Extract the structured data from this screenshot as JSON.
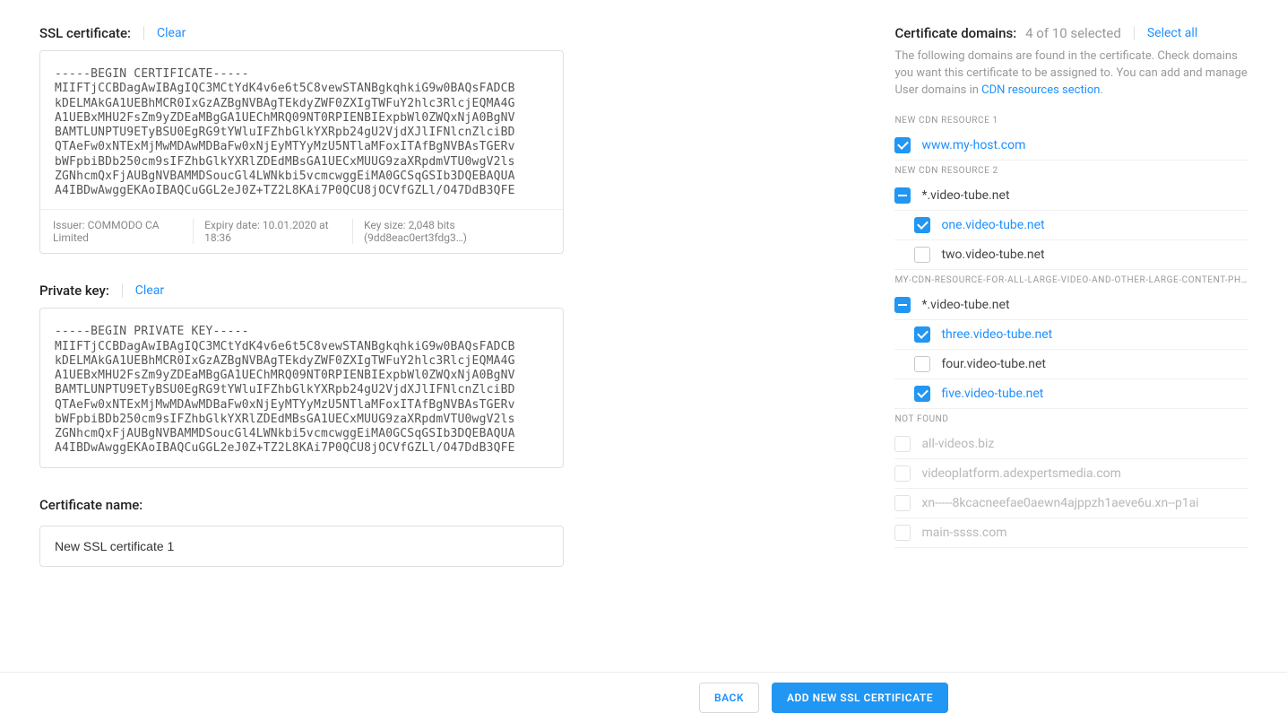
{
  "left": {
    "ssl_label": "SSL certificate:",
    "ssl_clear": "Clear",
    "cert_text": "-----BEGIN CERTIFICATE-----\nMIIFTjCCBDagAwIBAgIQC3MCtYdK4v6e6t5C8vewSTANBgkqhkiG9w0BAQsFADCB\nkDELMAkGA1UEBhMCR0IxGzAZBgNVBAgTEkdyZWF0ZXIgTWFuY2hlc3RlcjEQMA4G\nA1UEBxMHU2FsZm9yZDEaMBgGA1UEChMRQ09NT0RPIENBIExpbWl0ZWQxNjA0BgNV\nBAMTLUNPTU9ETyBSU0EgRG9tYWluIFZhbGlkYXRpb24gU2VjdXJlIFNlcnZlciBD\nQTAeFw0xNTExMjMwMDAwMDBaFw0xNjEyMTYyMzU5NTlaMFoxITAfBgNVBAsTGERv\nbWFpbiBDb250cm9sIFZhbGlkYXRlZDEdMBsGA1UECxMUUG9zaXRpdmVTU0wgV2ls\nZGNhcmQxFjAUBgNVBAMMDSoucGl4LWNkbi5vcmcwggEiMA0GCSqGSIb3DQEBAQUA\nA4IBDwAwggEKAoIBAQCuGGL2eJ0Z+TZ2L8KAi7P0QCU8jOCVfGZLl/O47DdB3QFE",
    "issuer_label": "Issuer: COMMODO CA Limited",
    "expiry_label": "Expiry date: 10.01.2020 at 18:36",
    "keysize_label": "Key size: 2,048 bits (9dd8eac0ert3fdg3…)",
    "pk_label": "Private key:",
    "pk_clear": "Clear",
    "pk_text": "-----BEGIN PRIVATE KEY-----\nMIIFTjCCBDagAwIBAgIQC3MCtYdK4v6e6t5C8vewSTANBgkqhkiG9w0BAQsFADCB\nkDELMAkGA1UEBhMCR0IxGzAZBgNVBAgTEkdyZWF0ZXIgTWFuY2hlc3RlcjEQMA4G\nA1UEBxMHU2FsZm9yZDEaMBgGA1UEChMRQ09NT0RPIENBIExpbWl0ZWQxNjA0BgNV\nBAMTLUNPTU9ETyBSU0EgRG9tYWluIFZhbGlkYXRpb24gU2VjdXJlIFNlcnZlciBD\nQTAeFw0xNTExMjMwMDAwMDBaFw0xNjEyMTYyMzU5NTlaMFoxITAfBgNVBAsTGERv\nbWFpbiBDb250cm9sIFZhbGlkYXRlZDEdMBsGA1UECxMUUG9zaXRpdmVTU0wgV2ls\nZGNhcmQxFjAUBgNVBAMMDSoucGl4LWNkbi5vcmcwggEiMA0GCSqGSIb3DQEBAQUA\nA4IBDwAwggEKAoIBAQCuGGL2eJ0Z+TZ2L8KAi7P0QCU8jOCVfGZLl/O47DdB3QFE",
    "cert_name_label": "Certificate name:",
    "cert_name_value": "New SSL certificate 1"
  },
  "right": {
    "title": "Certificate domains:",
    "count": "4 of 10 selected",
    "select_all": "Select all",
    "desc1": "The following domains are found in the certificate. Check domains you want this certificate to be assigned to. You can add and manage User domains in ",
    "desc_link": "CDN resources section",
    "desc_suffix": ".",
    "groups": [
      {
        "label": "NEW CDN RESOURCE 1",
        "rows": [
          {
            "state": "checked",
            "child": false,
            "text": "www.my-host.com",
            "selected": true
          }
        ]
      },
      {
        "label": "NEW CDN RESOURCE 2",
        "rows": [
          {
            "state": "indeterminate",
            "child": false,
            "text": "*.video-tube.net",
            "selected": false
          },
          {
            "state": "checked",
            "child": true,
            "text": "one.video-tube.net",
            "selected": true
          },
          {
            "state": "empty",
            "child": true,
            "text": "two.video-tube.net",
            "selected": false
          }
        ]
      },
      {
        "label": "MY-CDN-RESOURCE-FOR-ALL-LARGE-VIDEO-AND-OTHER-LARGE-CONTENT-PH…",
        "rows": [
          {
            "state": "indeterminate",
            "child": false,
            "text": "*.video-tube.net",
            "selected": false
          },
          {
            "state": "checked",
            "child": true,
            "text": "three.video-tube.net",
            "selected": true
          },
          {
            "state": "empty",
            "child": true,
            "text": "four.video-tube.net",
            "selected": false
          },
          {
            "state": "checked",
            "child": true,
            "text": "five.video-tube.net",
            "selected": true
          }
        ]
      },
      {
        "label": "NOT FOUND",
        "muted": true,
        "rows": [
          {
            "state": "empty",
            "child": false,
            "text": "all-videos.biz",
            "muted": true
          },
          {
            "state": "empty",
            "child": false,
            "text": "videoplatform.adexpertsmedia.com",
            "muted": true
          },
          {
            "state": "empty",
            "child": false,
            "text": "xn-----8kcacneefae0aewn4ajppzh1aeve6u.xn--p1ai",
            "muted": true
          },
          {
            "state": "empty",
            "child": false,
            "text": "main-ssss.com",
            "muted": true
          }
        ]
      }
    ]
  },
  "footer": {
    "back": "BACK",
    "add": "ADD NEW SSL CERTIFICATE"
  }
}
